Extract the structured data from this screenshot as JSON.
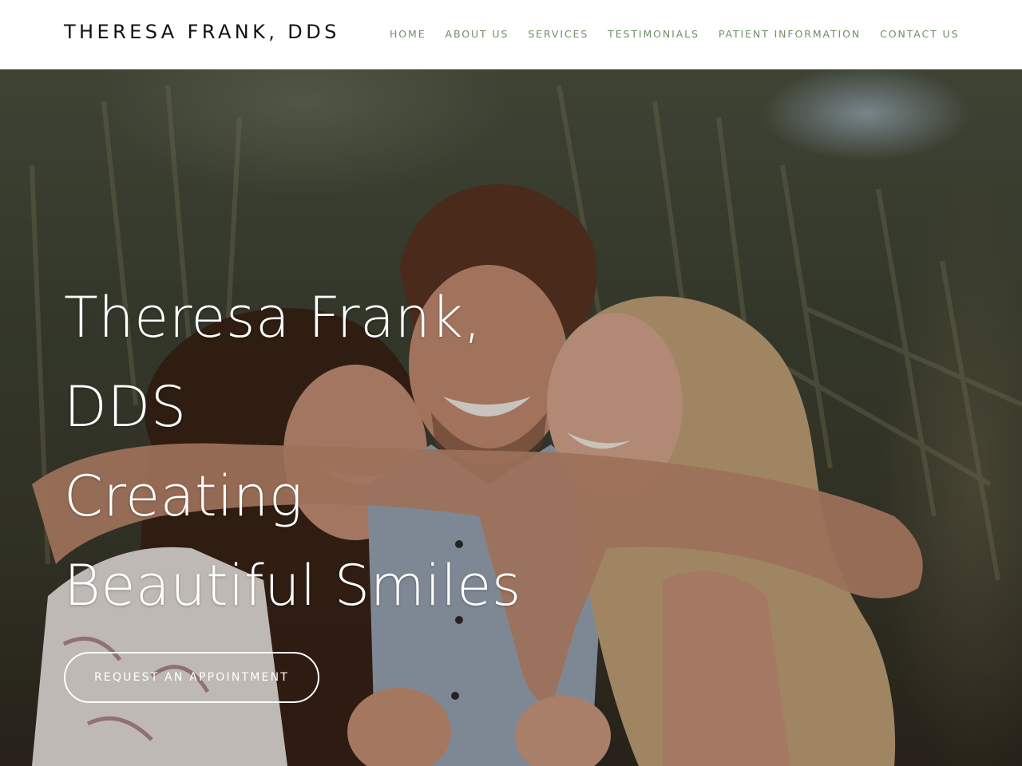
{
  "header": {
    "brand": "THERESA FRANK, DDS",
    "nav": [
      {
        "label": "HOME"
      },
      {
        "label": "ABOUT US"
      },
      {
        "label": "SERVICES"
      },
      {
        "label": "TESTIMONIALS"
      },
      {
        "label": "PATIENT INFORMATION"
      },
      {
        "label": "CONTACT US"
      }
    ]
  },
  "hero": {
    "title_lines": [
      "Theresa Frank,",
      "DDS",
      "Creating",
      "Beautiful Smiles"
    ],
    "cta_label": "REQUEST AN APPOINTMENT"
  },
  "colors": {
    "nav_text": "#6f9164",
    "brand_text": "#111111",
    "hero_text": "#ffffff",
    "header_bg": "#ffffff"
  }
}
